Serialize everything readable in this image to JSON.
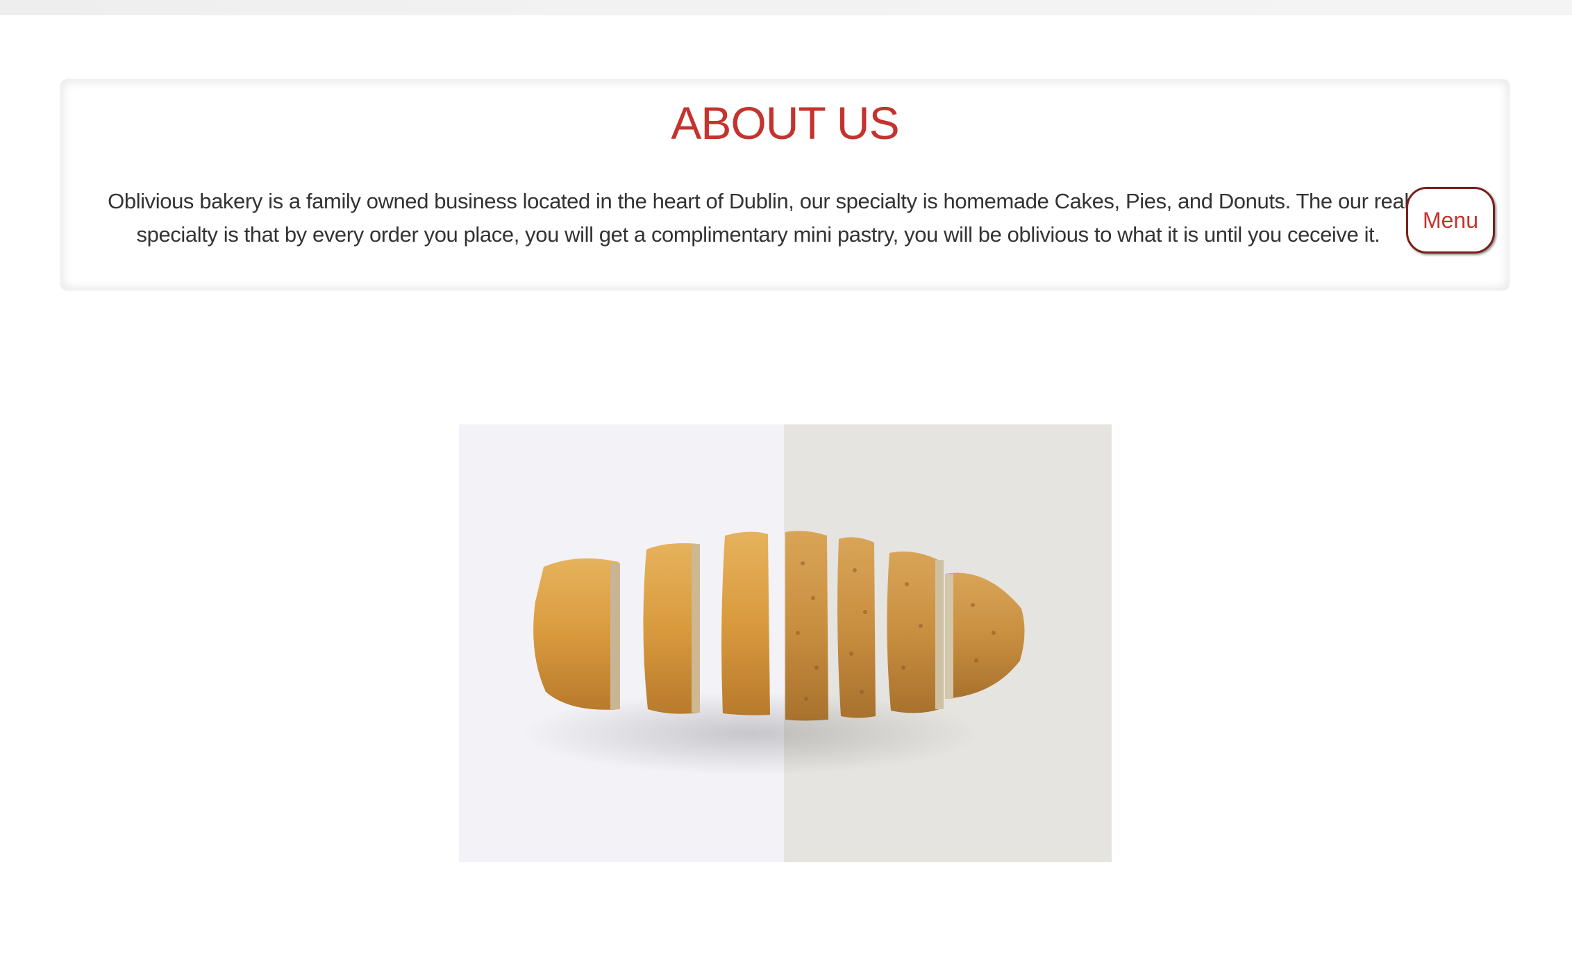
{
  "about": {
    "title": "ABOUT US",
    "text": "Oblivious bakery is a family owned business located in the heart of Dublin, our specialty is homemade Cakes, Pies, and Donuts. The our real specialty is that by every order you place, you will get a complimentary mini pastry, you will be oblivious to what it is until you ceceive it.",
    "menu_button": "Menu"
  },
  "image": {
    "icon": "sliced-bread-loaf-image"
  },
  "colors": {
    "accent": "#c4332d",
    "button_border": "#7a1f1a",
    "text": "#333333"
  }
}
